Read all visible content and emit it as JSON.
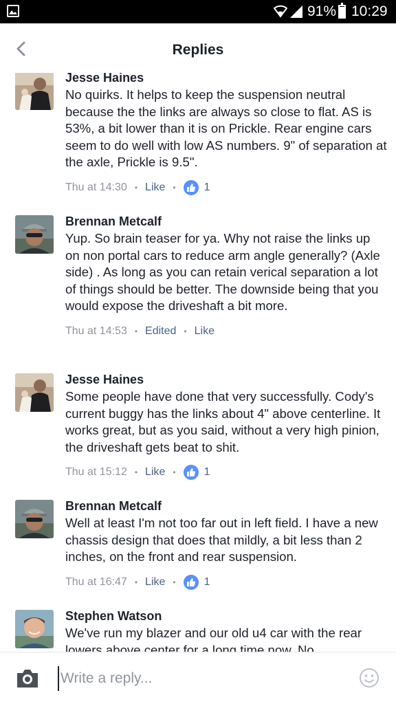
{
  "status_bar": {
    "battery": "91%",
    "time": "10:29"
  },
  "header": {
    "title": "Replies"
  },
  "replies": [
    {
      "author": "Jesse Haines",
      "text": "No quirks. It helps to keep the suspension neutral because the the links are always so close to flat. AS is 53%, a bit lower than it is on Prickle. Rear engine cars seem to do well with low AS numbers. 9\" of separation at the axle, Prickle is 9.5\".",
      "time": "Thu at 14:30",
      "like_label": "Like",
      "like_count": "1"
    },
    {
      "author": "Brennan Metcalf",
      "text": "Yup. So brain teaser for ya. Why not raise the links up on non portal cars to reduce arm angle generally? (Axle side) . As long as you can retain verical separation a lot of things should be better. The downside being that you would expose the driveshaft a bit more.",
      "time": "Thu at 14:53",
      "edited_label": "Edited",
      "like_label": "Like"
    },
    {
      "author": "Jesse Haines",
      "text": "Some people have done that very successfully. Cody's current buggy has the links about 4\" above centerline. It works great, but as you said, without a very high pinion, the driveshaft gets beat to shit.",
      "time": "Thu at 15:12",
      "like_label": "Like",
      "like_count": "1"
    },
    {
      "author": "Brennan Metcalf",
      "text": "Well at least I'm not too far out in left field. I have a new chassis design that does that mildly, a bit less than 2 inches, on the front and rear suspension.",
      "time": "Thu at 16:47",
      "like_label": "Like",
      "like_count": "1"
    },
    {
      "author": "Stephen Watson",
      "text": "We've run my blazer and our old u4 car with the rear lowers above center for a long time now. No"
    }
  ],
  "composer": {
    "placeholder": "Write a reply..."
  },
  "colors": {
    "like_blue": "#5890ff",
    "link": "#4b5f8a",
    "meta_gray": "#90949c"
  }
}
